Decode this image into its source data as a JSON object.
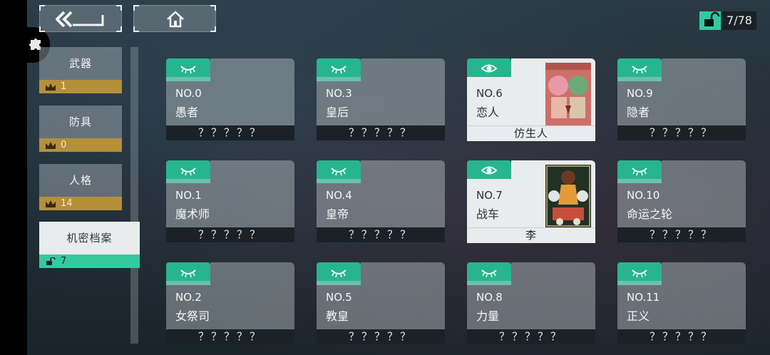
{
  "header": {
    "counter": "7/78",
    "back_icon": "double-chevron-left-icon",
    "home_icon": "home-icon",
    "lock_icon": "unlock-icon"
  },
  "sidebar": {
    "items": [
      {
        "label": "武器",
        "count": "1",
        "icon": "crown-icon"
      },
      {
        "label": "防具",
        "count": "0",
        "icon": "crown-icon"
      },
      {
        "label": "人格",
        "count": "14",
        "icon": "crown-icon"
      },
      {
        "label": "机密档案",
        "count": "7",
        "icon": "unlock-icon"
      }
    ]
  },
  "cards": [
    {
      "num": "NO.0",
      "name": "愚者",
      "footer": "？？？？？"
    },
    {
      "num": "NO.3",
      "name": "皇后",
      "footer": "？？？？？"
    },
    {
      "num": "NO.6",
      "name": "恋人",
      "footer": "仿生人"
    },
    {
      "num": "NO.9",
      "name": "隐者",
      "footer": "？？？？？"
    },
    {
      "num": "NO.1",
      "name": "魔术师",
      "footer": "？？？？？"
    },
    {
      "num": "NO.4",
      "name": "皇帝",
      "footer": "？？？？？"
    },
    {
      "num": "NO.7",
      "name": "战车",
      "footer": "李"
    },
    {
      "num": "NO.10",
      "name": "命运之轮",
      "footer": "？？？？？"
    },
    {
      "num": "NO.2",
      "name": "女祭司",
      "footer": "？？？？？"
    },
    {
      "num": "NO.5",
      "name": "教皇",
      "footer": "？？？？？"
    },
    {
      "num": "NO.8",
      "name": "力量",
      "footer": "？？？？？"
    },
    {
      "num": "NO.11",
      "name": "正义",
      "footer": "？？？？？"
    }
  ],
  "colors": {
    "accent": "#27b58f",
    "gold": "#b58f3a"
  }
}
